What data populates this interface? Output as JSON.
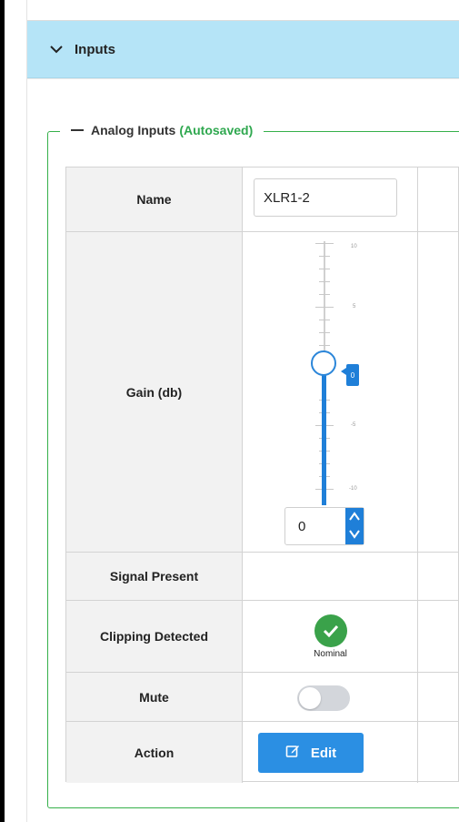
{
  "section": {
    "title": "Inputs",
    "expanded": true
  },
  "group": {
    "title": "Analog Inputs",
    "status": "(Autosaved)"
  },
  "rows": {
    "name": {
      "label": "Name",
      "value": "XLR1-2"
    },
    "gain": {
      "label": "Gain (db)",
      "value": 0,
      "min": -10,
      "max": 10,
      "tick_labels": [
        "10",
        "5",
        "0",
        "-5",
        "-10"
      ],
      "flag_label": "0",
      "spinner_value": "0"
    },
    "signal_present": {
      "label": "Signal Present",
      "value": ""
    },
    "clipping": {
      "label": "Clipping Detected",
      "status": "Nominal",
      "icon": "check-icon"
    },
    "mute": {
      "label": "Mute",
      "enabled": false
    },
    "action": {
      "label": "Action",
      "button": "Edit",
      "icon": "edit-icon"
    }
  },
  "colors": {
    "accent": "#2b8fe3",
    "header_bg": "#b5e4f7",
    "fieldset_border": "#35b04a",
    "ok": "#3aa24a"
  }
}
